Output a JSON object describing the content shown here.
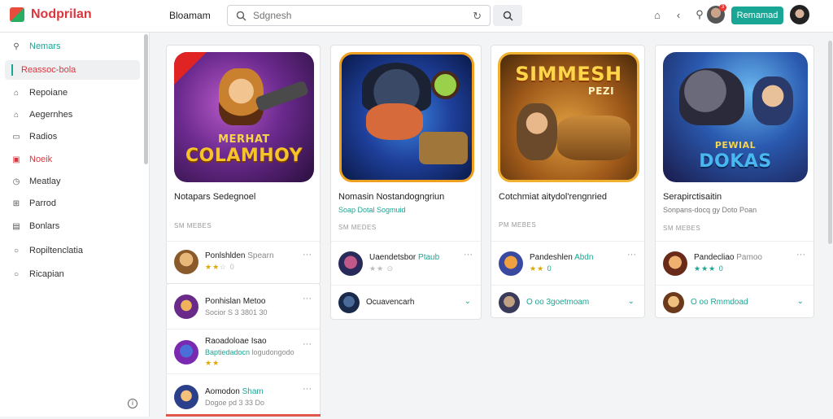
{
  "app": {
    "title": "Nodprilan"
  },
  "header": {
    "section": "Bloamam",
    "search_placeholder": "Sdgnesh",
    "cta_label": "Remamad",
    "notif_count": "3"
  },
  "sidebar": {
    "items": [
      {
        "label": "Nemars",
        "color": "#1aa694"
      },
      {
        "label": "Reassoc-bola",
        "color": "#d9363e"
      },
      {
        "label": "Repoiane",
        "color": "#333333"
      },
      {
        "label": "Aegernhes",
        "color": "#333333"
      },
      {
        "label": "Radios",
        "color": "#333333"
      },
      {
        "label": "Noeik",
        "color": "#d9363e"
      },
      {
        "label": "Meatlay",
        "color": "#333333"
      },
      {
        "label": "Parrod",
        "color": "#333333"
      },
      {
        "label": "Bonlars",
        "color": "#333333"
      },
      {
        "label": "Ropiltenclatia",
        "color": "#333333"
      },
      {
        "label": "Ricapian",
        "color": "#333333"
      }
    ]
  },
  "cards": [
    {
      "art_title": "COLAMHOY",
      "art_kicker": "MERHAT",
      "title": "Notapars Sedegnoel",
      "sub": "",
      "meta": "SM MEBES",
      "row": {
        "title": "Ponlshlden",
        "title_accent": "",
        "title_extra": "Spearn",
        "stars": "★★"
      },
      "chev": null
    },
    {
      "art_title": "",
      "art_kicker": "",
      "title": "Nomasin Nostandogngriun",
      "sub": "Soap  Dotal  Sogmuid",
      "meta": "SM MEDES",
      "row": {
        "title": "Uaendetsbor",
        "title_accent": "Ptaub",
        "title_extra": "",
        "stars": "★★"
      },
      "chev": {
        "title": "Ocuavencarh"
      }
    },
    {
      "art_title": "SIMMESH",
      "art_kicker": "PEZI",
      "title": "Cotchmiat aitydol'rengnried",
      "sub": "",
      "meta": "PM MEBES",
      "row": {
        "title": "Pandeshlen",
        "title_accent": "Abdn",
        "title_extra": "",
        "stars": "★★"
      },
      "chev": {
        "title": "O  oo 3goetmoam"
      }
    },
    {
      "art_title": "DOKAS",
      "art_kicker": "PEWIAL",
      "title": "Serapirctisaitin",
      "sub": "Sonpans-docq gy Doto  Poan",
      "meta": "SM MEBES",
      "row": {
        "title": "Pandecliao",
        "title_accent": "",
        "title_extra": "Pamoo",
        "stars": "★★★"
      },
      "chev": {
        "title": "O  oo Rmmdoad"
      }
    }
  ],
  "left_list": [
    {
      "title": "Ponhislan Metoo",
      "sub": "Socior S  3 3801 30",
      "accent": ""
    },
    {
      "title": "Raoadoloae Isao",
      "sub": "logudongodo",
      "accent": "Baptiedadocn"
    },
    {
      "title": "Aomodon",
      "sub": "Dogoe pd 3 33 Do",
      "accent": "Sham"
    }
  ]
}
